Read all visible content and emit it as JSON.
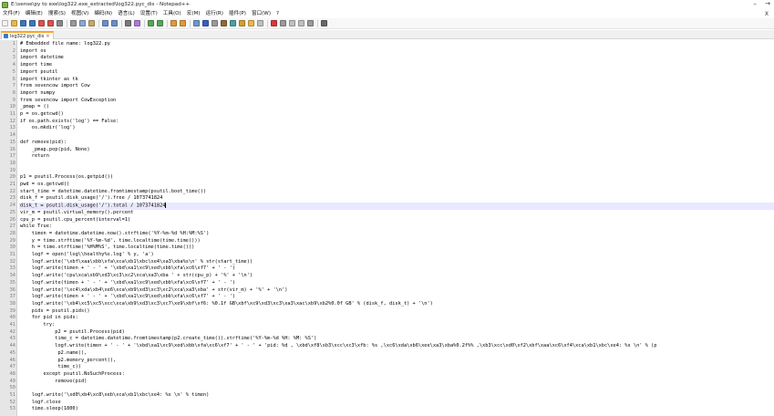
{
  "window": {
    "title": "E:\\sense\\py to exe\\log322.exe_extracted\\log322.pyc_dis - Notepad++",
    "controls": [
      "–",
      "→"
    ]
  },
  "menu": {
    "items": [
      "文件(F)",
      "编辑(E)",
      "搜索(S)",
      "视图(V)",
      "编码(N)",
      "语言(L)",
      "设置(T)",
      "工具(O)",
      "宏(M)",
      "运行(R)",
      "插件(P)",
      "窗口(W)",
      "?"
    ],
    "close_doc": "X"
  },
  "toolbar": {
    "buttons": [
      {
        "name": "new-file-icon",
        "color": "#f2f2f2"
      },
      {
        "name": "open-folder-icon",
        "color": "#e8b84a"
      },
      {
        "name": "save-icon",
        "color": "#3a78c3"
      },
      {
        "name": "save-all-icon",
        "color": "#3a78c3"
      },
      {
        "name": "close-icon",
        "color": "#d9534f"
      },
      {
        "name": "close-all-icon",
        "color": "#d9534f"
      },
      {
        "name": "print-icon",
        "color": "#8a8a8a"
      },
      {
        "sep": true
      },
      {
        "name": "cut-icon",
        "color": "#9a9a9a"
      },
      {
        "name": "copy-icon",
        "color": "#8aa8d0"
      },
      {
        "name": "paste-icon",
        "color": "#c8a86a"
      },
      {
        "sep": true
      },
      {
        "name": "undo-icon",
        "color": "#6b8fc9"
      },
      {
        "name": "redo-icon",
        "color": "#6b8fc9"
      },
      {
        "sep": true
      },
      {
        "name": "find-icon",
        "color": "#7a7a7a"
      },
      {
        "name": "replace-icon",
        "color": "#b07ad0"
      },
      {
        "sep": true
      },
      {
        "name": "zoom-in-icon",
        "color": "#5aa65a"
      },
      {
        "name": "zoom-out-icon",
        "color": "#5aa65a"
      },
      {
        "sep": true
      },
      {
        "name": "sync-vertical-icon",
        "color": "#e09a3a"
      },
      {
        "name": "sync-horizontal-icon",
        "color": "#e09a3a"
      },
      {
        "sep": true
      },
      {
        "name": "word-wrap-icon",
        "color": "#6a9ad0"
      },
      {
        "name": "all-chars-icon",
        "color": "#3a5fbf"
      },
      {
        "name": "indent-guide-icon",
        "color": "#9a9a9a"
      },
      {
        "name": "user-lang-icon",
        "color": "#8f6a3a"
      },
      {
        "name": "doc-map-icon",
        "color": "#4aa0a0"
      },
      {
        "name": "function-list-icon",
        "color": "#d0a030"
      },
      {
        "name": "folder-workspace-icon",
        "color": "#e8b84a"
      },
      {
        "name": "monitor-icon",
        "color": "#bfbfbf"
      },
      {
        "sep": true
      },
      {
        "name": "record-macro-icon",
        "color": "#d33a3a"
      },
      {
        "name": "stop-record-icon",
        "color": "#9a9a9a"
      },
      {
        "name": "play-macro-icon",
        "color": "#bfbfbf"
      },
      {
        "name": "run-macro-multiple-icon",
        "color": "#bfbfbf"
      },
      {
        "name": "save-macro-icon",
        "color": "#9a9a9a"
      },
      {
        "sep": true
      },
      {
        "name": "abc-spellcheck-icon",
        "color": "#6a6a6a"
      }
    ]
  },
  "tab": {
    "label": "log322.pyc_dis",
    "close": "✕"
  },
  "editor": {
    "current_line": 24,
    "lines": [
      "# Embedded file name: log322.py",
      "import os",
      "import datetime",
      "import time",
      "import psutil",
      "import tkinter as tk",
      "from sevencow import Cow",
      "import numpy",
      "from sevencow import CowException",
      "_pmap = ()",
      "p = os.getcwd()",
      "if os.path.exists('log') == False:",
      "    os.mkdir('log')",
      "",
      "def remove(pid):",
      "    _pmap.pop(pid, None)",
      "    return",
      "",
      "",
      "p1 = psutil.Process(os.getpid())",
      "pwd = os.getcwd()",
      "start_time = datetime.datetime.fromtimestamp(psutil.boot_time())",
      "disk_f = psutil.disk_usage('/').free / 1073741824",
      "disk_t = psutil.disk_usage('/').total / 1073741824",
      "vir_m = psutil.virtual_memory().percent",
      "cpu_p = psutil.cpu_percent(interval=1)",
      "while True:",
      "    timen = datetime.datetime.now().strftime('%Y-%m-%d %H:%M:%S')",
      "    y = time.strftime('%Y-%m-%d', time.localtime(time.time()))",
      "    h = time.strftime('%H%M%S', time.localtime(time.time()))",
      "    logf = open('log\\\\healthy%s.log' % y, 'a')",
      "    logf.write('\\xbf\\xaa\\xbb\\xfa\\xca\\xb1\\xbc\\xe4\\xa3\\xba%s\\n' % str(start_time))",
      "    logf.write(timen + ' - ' + '\\xbd\\xa1\\xc9\\xed\\xbb\\xfa\\xc6\\xf7' + ' - ')",
      "    logf.write('cpu\\xca\\xb9\\xd3\\xc3\\xc2\\xca\\xa3\\xba ' + str(cpu_p) + '%' + '\\n')",
      "    logf.write(timen + ' - ' + '\\xbd\\xa1\\xc9\\xed\\xbb\\xfa\\xc6\\xf7' + ' - ')",
      "    logf.write('\\xc4\\xda\\xb4\\xe6\\xca\\xb9\\xd3\\xc3\\xc2\\xca\\xa3\\xba' + str(vir_m) + '%' + '\\n')",
      "    logf.write(timen + ' - ' + '\\xbd\\xa1\\xc9\\xed\\xbb\\xfa\\xc6\\xf7' + ' - ')",
      "    logf.write('\\xb4\\xc5\\xc5\\xcc\\xca\\xb9\\xd3\\xc3\\xc7\\xe9\\xbf\\xf6: %0.1f GB\\xbf\\xc9\\xd3\\xc3\\xa3\\xac\\xb9\\xb2%0.0f GB' % (disk_f, disk_t) + '\\n')",
      "    pids = psutil.pids()",
      "    for pid in pids:",
      "        try:",
      "            p2 = psutil.Process(pid)",
      "            time_c = datetime.datetime.fromtimestamp(p2.create_time()).strftime('%Y-%m-%d %H: %M: %S')",
      "            logf.write(timen + ' - ' + '\\xbd\\xa1\\xc9\\xed\\xbb\\xfa\\xc6\\xf7' + ' - ' + 'pid: %d , \\xbd\\xf8\\xb3\\xcc\\xc3\\xfb: %s ,\\xc6\\xda\\xb6\\xee\\xa3\\xba%0.2f%% ,\\xb3\\xcc\\xd0\\xf2\\xbf\\xaa\\xc6\\xf4\\xca\\xb1\\xbc\\xe4: %s \\n' % (p",
      "             p2.name(),",
      "             p2.memory_percent(),",
      "             time_c))",
      "        except psutil.NoSuchProcess:",
      "            remove(pid)",
      "",
      "    logf.write('\\xd0\\xb4\\xc8\\xeb\\xca\\xb1\\xbc\\xe4: %s \\n' % timen)",
      "    logf.close",
      "    time.sleep(1800)"
    ]
  }
}
